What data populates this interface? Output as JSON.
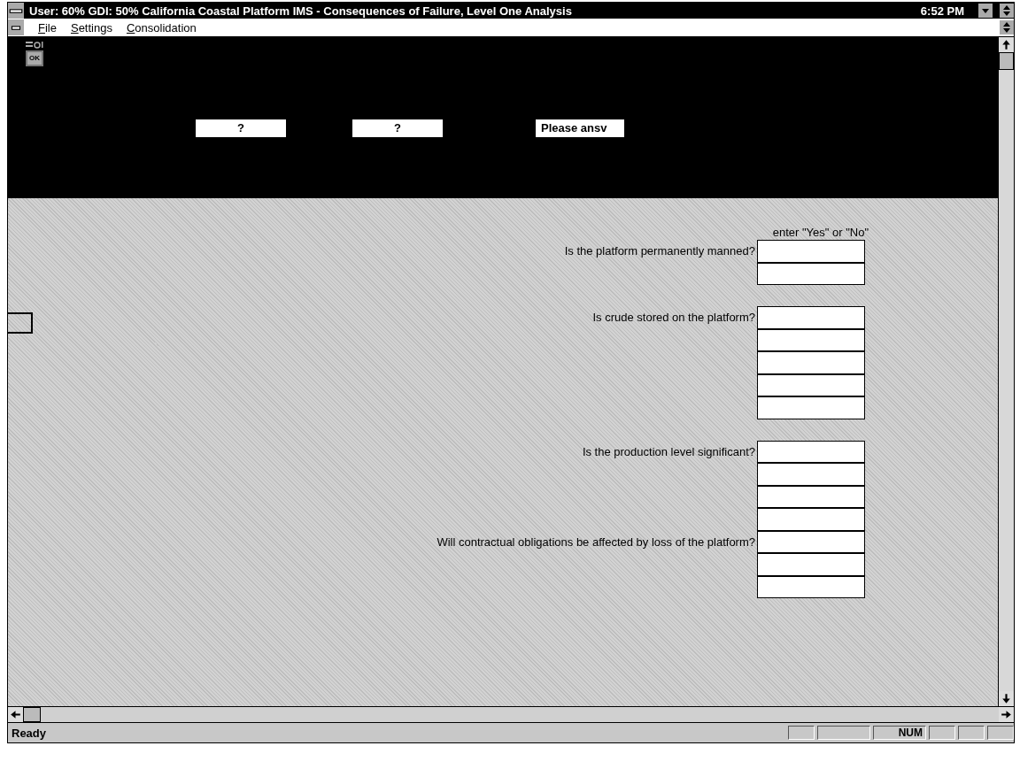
{
  "window": {
    "title": "User: 60% GDI: 50%  California Coastal Platform IMS - Consequences of Failure, Level One Analysis",
    "clock": "6:52 PM"
  },
  "menu": [
    "File",
    "Settings",
    "Consolidation"
  ],
  "toolbar": {
    "ok_button": "OK",
    "fields": [
      {
        "kind": "button",
        "text": "?"
      },
      {
        "kind": "button",
        "text": "?"
      },
      {
        "kind": "note",
        "text": "Please ansv"
      }
    ]
  },
  "form": {
    "hint": "enter \"Yes\" or \"No\"",
    "rows": [
      {
        "kind": "question",
        "text": "Is the platform permanently manned?"
      },
      {
        "kind": "blank"
      },
      {
        "kind": "gap"
      },
      {
        "kind": "question",
        "text": "Is crude stored on the platform?"
      },
      {
        "kind": "blank"
      },
      {
        "kind": "blank"
      },
      {
        "kind": "blank"
      },
      {
        "kind": "blank"
      },
      {
        "kind": "gap"
      },
      {
        "kind": "question",
        "text": "Is the production level significant?"
      },
      {
        "kind": "blank"
      },
      {
        "kind": "blank"
      },
      {
        "kind": "blank"
      },
      {
        "kind": "question",
        "text": "Will contractual obligations be affected by loss of the platform?"
      },
      {
        "kind": "blank"
      },
      {
        "kind": "blank"
      }
    ]
  },
  "status_bar": {
    "text": "Ready",
    "indicators": [
      "NUM"
    ]
  }
}
